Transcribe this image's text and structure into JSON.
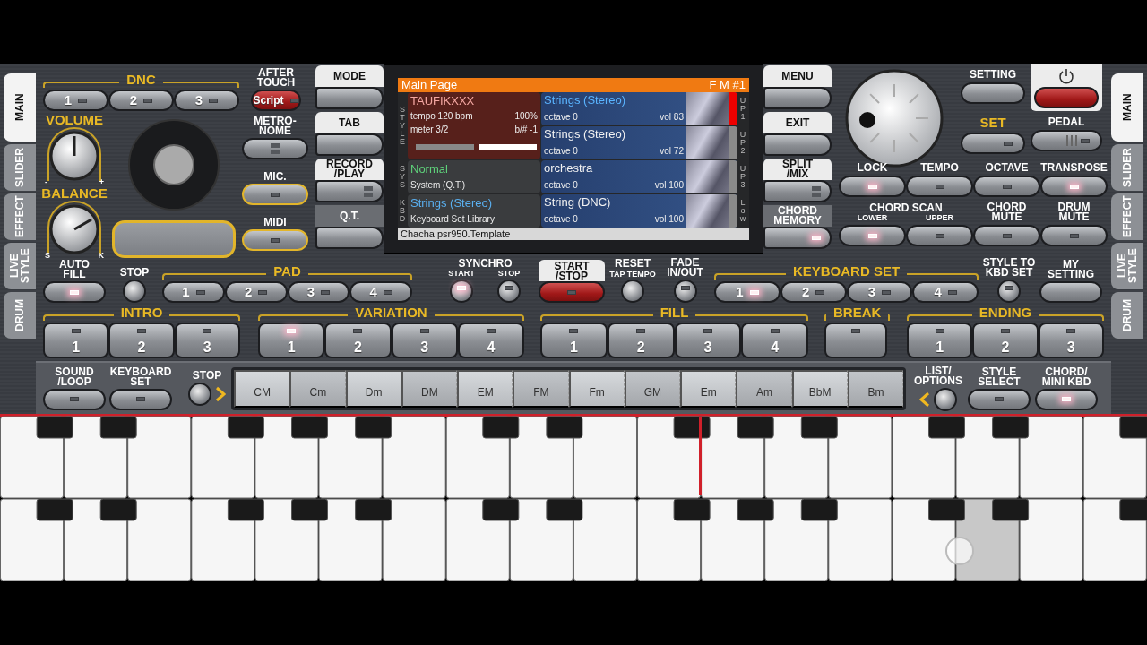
{
  "side_tabs_left": [
    {
      "label": "MAIN",
      "selected": true
    },
    {
      "label": "SLIDER",
      "selected": false
    },
    {
      "label": "EFFECT",
      "selected": false
    },
    {
      "label": "LIVE STYLE",
      "selected": false
    },
    {
      "label": "DRUM",
      "selected": false
    }
  ],
  "dnc": {
    "title": "DNC",
    "buttons": [
      {
        "label": "1",
        "lit": false
      },
      {
        "label": "2",
        "lit": false
      },
      {
        "label": "3",
        "lit": false
      }
    ]
  },
  "after_touch": {
    "label": "AFTER\nTOUCH",
    "button": {
      "label": "Script",
      "lit": false,
      "active": true
    }
  },
  "volume": {
    "label": "VOLUME",
    "min_label": "-",
    "max_label": "+"
  },
  "balance": {
    "label": "BALANCE",
    "min_label": "S",
    "max_label": "K"
  },
  "side_buttons": [
    {
      "label": "METRO-\nNOME",
      "kind": "double",
      "lit": false,
      "outlined": false
    },
    {
      "label": "MIC.",
      "lit": false,
      "outlined": true
    },
    {
      "label": "MIDI",
      "lit": false,
      "outlined": true
    }
  ],
  "mode_column": [
    {
      "label": "MODE",
      "highlighted": true
    },
    {
      "label": "TAB",
      "highlighted": true
    },
    {
      "label": "RECORD\n/PLAY",
      "highlighted": true,
      "kind": "double",
      "lit": false
    },
    {
      "label": "Q.T.",
      "highlighted": false
    }
  ],
  "display": {
    "title": "Main Page",
    "mode": "F M #1",
    "style": {
      "side_label": "STYLE",
      "name": "TAUFIKXXX",
      "tempo": "tempo 120 bpm",
      "tempo_percent": "100%",
      "meter": "meter 3/2",
      "transpose": "b/# -1"
    },
    "system": {
      "side_label": "SYS",
      "name": "Normal",
      "detail": "System (Q.T.)"
    },
    "keyboard_set": {
      "side_label": "KBD",
      "name": "Strings (Stereo)",
      "detail": "Keyboard Set Library"
    },
    "parts": [
      {
        "side_label": "UP1",
        "name": "Strings (Stereo)",
        "octave": "octave 0",
        "volume": "vol 83",
        "selected": true
      },
      {
        "side_label": "UP2",
        "name": "Strings (Stereo)",
        "octave": "octave 0",
        "volume": "vol 72",
        "selected": false
      },
      {
        "side_label": "UP3",
        "name": "orchestra",
        "octave": "octave 0",
        "volume": "vol 100",
        "selected": false
      },
      {
        "side_label": "Low",
        "name": "String (DNC)",
        "octave": "octave 0",
        "volume": "vol 100",
        "selected": false
      }
    ],
    "footer": "Chacha psr950.Template"
  },
  "menu_column": [
    {
      "label": "MENU",
      "highlighted": true
    },
    {
      "label": "EXIT",
      "highlighted": true
    },
    {
      "label": "SPLIT\n/MIX",
      "highlighted": true,
      "kind": "double",
      "lit": false
    },
    {
      "label": "CHORD\nMEMORY",
      "highlighted": false,
      "lit": true
    }
  ],
  "setting": {
    "label": "SETTING"
  },
  "power": {
    "highlighted": true,
    "active": true
  },
  "set": {
    "title": "SET",
    "lit": false
  },
  "pedal": {
    "label": "PEDAL",
    "lit": false
  },
  "lock_row": [
    {
      "label": "LOCK",
      "lit": true
    },
    {
      "label": "TEMPO",
      "lit": false
    },
    {
      "label": "OCTAVE",
      "lit": false
    },
    {
      "label": "TRANSPOSE",
      "lit": true
    }
  ],
  "chord_scan": {
    "label": "CHORD SCAN",
    "buttons": [
      {
        "label": "LOWER",
        "lit": true
      },
      {
        "label": "UPPER",
        "lit": false
      }
    ]
  },
  "mute_buttons": [
    {
      "label": "CHORD\nMUTE",
      "lit": false
    },
    {
      "label": "DRUM\nMUTE",
      "lit": false
    }
  ],
  "auto_fill": {
    "label": "AUTO\nFILL",
    "lit": true
  },
  "pad": {
    "title": "PAD",
    "stop": {
      "label": "STOP"
    },
    "buttons": [
      {
        "label": "1",
        "lit": false
      },
      {
        "label": "2",
        "lit": false
      },
      {
        "label": "3",
        "lit": false
      },
      {
        "label": "4",
        "lit": false
      }
    ]
  },
  "synchro": {
    "title": "SYNCHRO",
    "buttons": [
      {
        "label": "START",
        "lit": true
      },
      {
        "label": "STOP",
        "lit": false
      }
    ]
  },
  "start_stop": {
    "label": "START\n/STOP",
    "highlighted": true,
    "active": true,
    "lit": false
  },
  "reset": {
    "label": "RESET",
    "sublabel": "TAP TEMPO"
  },
  "fade": {
    "label": "FADE\nIN/OUT",
    "lit": false
  },
  "keyboard_set": {
    "title": "KEYBOARD SET",
    "buttons": [
      {
        "label": "1",
        "lit": true
      },
      {
        "label": "2",
        "lit": false
      },
      {
        "label": "3",
        "lit": false
      },
      {
        "label": "4",
        "lit": false
      }
    ]
  },
  "style_to_kbd": {
    "label": "STYLE TO\nKBD SET",
    "lit": false
  },
  "my_setting": {
    "label": "MY\nSETTING"
  },
  "sections": [
    {
      "title": "INTRO",
      "buttons": [
        {
          "label": "1",
          "lit": false
        },
        {
          "label": "2",
          "lit": false
        },
        {
          "label": "3",
          "lit": false
        }
      ]
    },
    {
      "title": "VARIATION",
      "buttons": [
        {
          "label": "1",
          "lit": true
        },
        {
          "label": "2",
          "lit": false
        },
        {
          "label": "3",
          "lit": false
        },
        {
          "label": "4",
          "lit": false
        }
      ]
    },
    {
      "title": "FILL",
      "buttons": [
        {
          "label": "1",
          "lit": false
        },
        {
          "label": "2",
          "lit": false
        },
        {
          "label": "3",
          "lit": false
        },
        {
          "label": "4",
          "lit": false
        }
      ]
    },
    {
      "title": "BREAK",
      "buttons": [
        {
          "lit": false
        }
      ]
    },
    {
      "title": "ENDING",
      "buttons": [
        {
          "label": "1",
          "lit": false
        },
        {
          "label": "2",
          "lit": false
        },
        {
          "label": "3",
          "lit": false
        }
      ]
    }
  ],
  "sound_loop": {
    "label": "SOUND\n/LOOP",
    "lit": false
  },
  "keyboard_set_button": {
    "label": "KEYBOARD\nSET",
    "lit": false
  },
  "chord_stop": {
    "label": "STOP"
  },
  "chords": [
    "CM",
    "Cm",
    "Dm",
    "DM",
    "EM",
    "FM",
    "Fm",
    "GM",
    "Em",
    "Am",
    "BbM",
    "Bm"
  ],
  "list_options": {
    "label": "LIST/\nOPTIONS"
  },
  "style_select": {
    "label": "STYLE\nSELECT",
    "lit": false
  },
  "chord_mini_kbd": {
    "label": "CHORD/\nMINI KBD",
    "lit": true
  },
  "side_tabs_right": [
    {
      "label": "MAIN",
      "selected": true
    },
    {
      "label": "SLIDER",
      "selected": false
    },
    {
      "label": "EFFECT",
      "selected": false
    },
    {
      "label": "LIVE STYLE",
      "selected": false
    },
    {
      "label": "DRUM",
      "selected": false
    }
  ]
}
